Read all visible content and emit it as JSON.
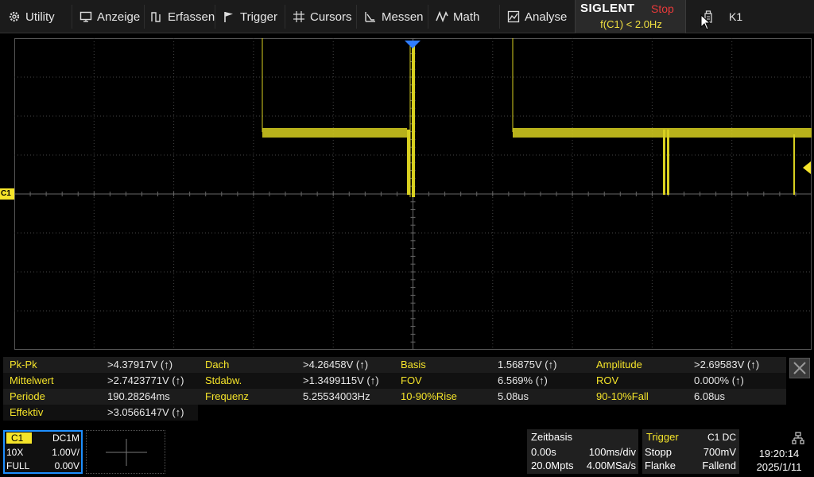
{
  "menu": [
    {
      "label": "Utility",
      "icon": "gear-icon"
    },
    {
      "label": "Anzeige",
      "icon": "display-icon"
    },
    {
      "label": "Erfassen",
      "icon": "acquire-icon"
    },
    {
      "label": "Trigger",
      "icon": "flag-icon"
    },
    {
      "label": "Cursors",
      "icon": "cursor-cross-icon"
    },
    {
      "label": "Messen",
      "icon": "measure-icon"
    },
    {
      "label": "Math",
      "icon": "math-icon"
    },
    {
      "label": "Analyse",
      "icon": "analyze-icon"
    }
  ],
  "status": {
    "brand": "SIGLENT",
    "run_state": "Stop",
    "warning": "f(C1) < 2.0Hz",
    "k1": "K1"
  },
  "channel_marker": "C1",
  "measurements": [
    [
      {
        "label": "Pk-Pk",
        "value": ">4.37917V (↑)"
      },
      {
        "label": "Dach",
        "value": ">4.26458V (↑)"
      },
      {
        "label": "Basis",
        "value": "1.56875V (↑)"
      },
      {
        "label": "Amplitude",
        "value": ">2.69583V (↑)"
      }
    ],
    [
      {
        "label": "Mittelwert",
        "value": ">2.7423771V (↑)"
      },
      {
        "label": "Stdabw.",
        "value": ">1.3499115V (↑)"
      },
      {
        "label": "FOV",
        "value": "6.569% (↑)"
      },
      {
        "label": "ROV",
        "value": "0.000% (↑)"
      }
    ],
    [
      {
        "label": "Periode",
        "value": "190.28264ms"
      },
      {
        "label": "Frequenz",
        "value": "5.25534003Hz"
      },
      {
        "label": "10-90%Rise",
        "value": "5.08us"
      },
      {
        "label": "90-10%Fall",
        "value": "6.08us"
      }
    ],
    [
      {
        "label": "Effektiv",
        "value": ">3.0566147V (↑)"
      }
    ]
  ],
  "channel_panel": {
    "name": "C1",
    "coupling": "DC1M",
    "probe": "10X",
    "scale": "1.00V/",
    "bandwidth": "FULL",
    "offset": "0.00V"
  },
  "timebase": {
    "title": "Zeitbasis",
    "delay": "0.00s",
    "scale": "100ms/div",
    "memory": "20.0Mpts",
    "sample_rate": "4.00MSa/s"
  },
  "trigger": {
    "title": "Trigger",
    "source": "C1 DC",
    "mode": "Stopp",
    "level": "700mV",
    "type": "Flanke",
    "slope": "Fallend"
  },
  "clock": {
    "time": "19:20:14",
    "date": "2025/1/11"
  },
  "colors": {
    "trace": "#d8d020",
    "accent": "#f5e42a",
    "stop": "#e83a3a",
    "selected": "#1e8fff"
  }
}
